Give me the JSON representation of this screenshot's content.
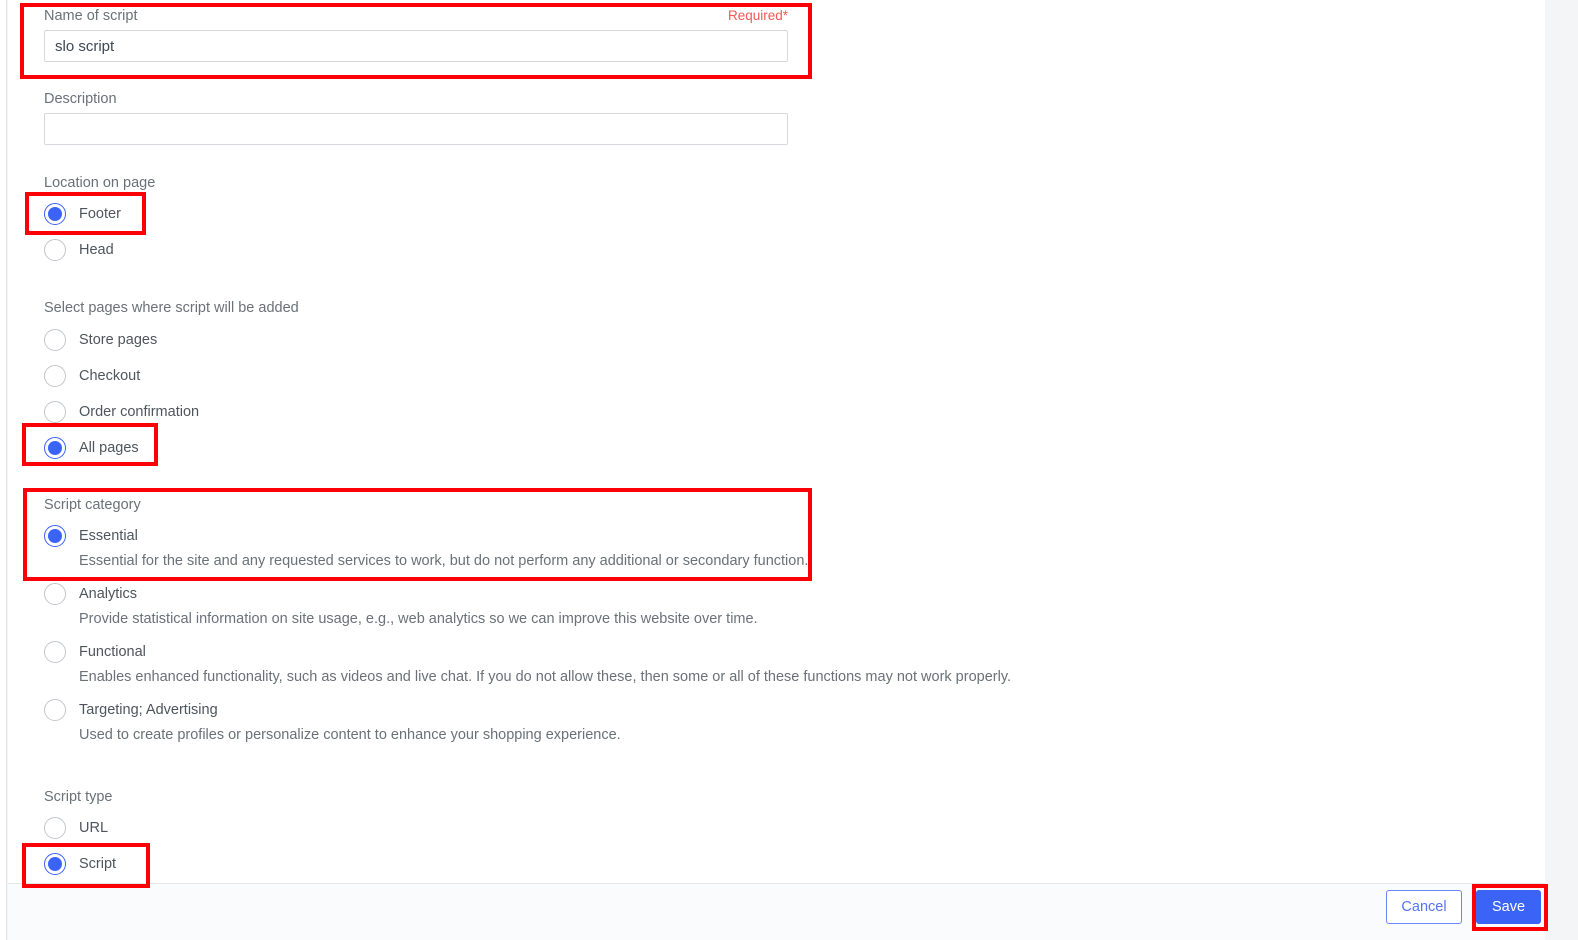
{
  "form": {
    "name_field": {
      "label": "Name of script",
      "required_tag": "Required*",
      "value": "slo script",
      "placeholder": ""
    },
    "description_field": {
      "label": "Description",
      "value": "",
      "placeholder": ""
    },
    "location_on_page": {
      "label": "Location on page",
      "options": [
        {
          "label": "Footer",
          "selected": true
        },
        {
          "label": "Head",
          "selected": false
        }
      ]
    },
    "pages": {
      "label": "Select pages where script will be added",
      "options": [
        {
          "label": "Store pages",
          "selected": false
        },
        {
          "label": "Checkout",
          "selected": false
        },
        {
          "label": "Order confirmation",
          "selected": false
        },
        {
          "label": "All pages",
          "selected": true
        }
      ]
    },
    "script_category": {
      "label": "Script category",
      "options": [
        {
          "label": "Essential",
          "description": "Essential for the site and any requested services to work, but do not perform any additional or secondary function.",
          "selected": true
        },
        {
          "label": "Analytics",
          "description": "Provide statistical information on site usage, e.g., web analytics so we can improve this website over time.",
          "selected": false
        },
        {
          "label": "Functional",
          "description": "Enables enhanced functionality, such as videos and live chat. If you do not allow these, then some or all of these functions may not work properly.",
          "selected": false
        },
        {
          "label": "Targeting; Advertising",
          "description": "Used to create profiles or personalize content to enhance your shopping experience.",
          "selected": false
        }
      ]
    },
    "script_type": {
      "label": "Script type",
      "options": [
        {
          "label": "URL",
          "selected": false
        },
        {
          "label": "Script",
          "selected": true
        }
      ]
    }
  },
  "footer": {
    "cancel_label": "Cancel",
    "save_label": "Save"
  },
  "colors": {
    "accent": "#3b63f6",
    "required": "#ef5b54",
    "highlight": "#fb0006",
    "label_text": "#6a7178",
    "option_text": "#4e555c"
  }
}
